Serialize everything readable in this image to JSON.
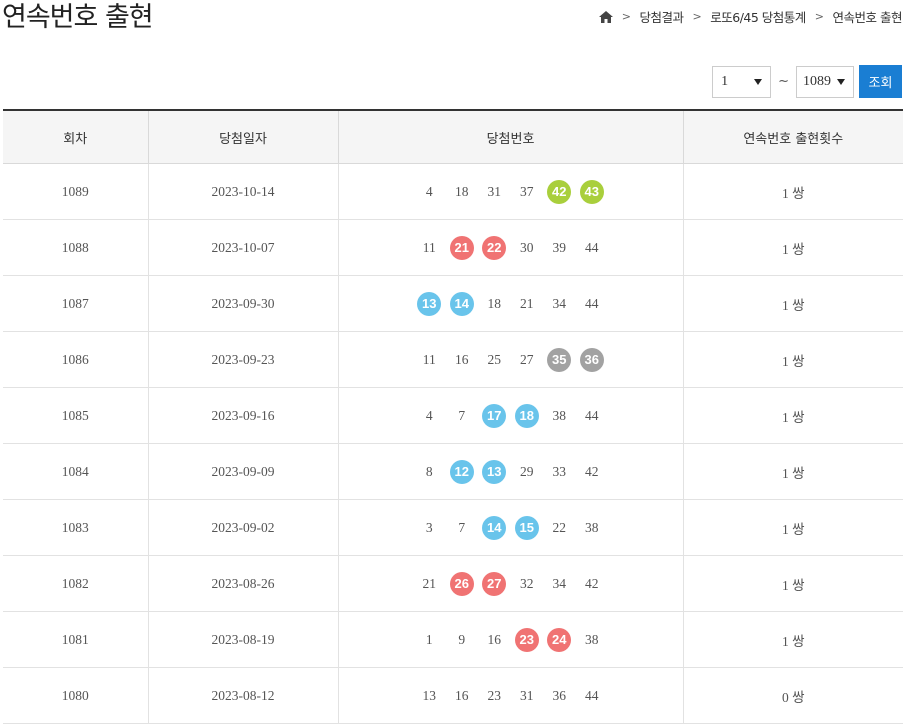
{
  "page_title": "연속번호 출현",
  "breadcrumb": {
    "home_icon": "home-icon",
    "items": [
      "당첨결과",
      "로또6/45 당첨통계",
      "연속번호 출현"
    ]
  },
  "filter": {
    "from_value": "1",
    "separator": "~",
    "to_value": "1089",
    "search_label": "조회"
  },
  "colors": {
    "yellow_green": "#a9cf3c",
    "red": "#f07373",
    "blue": "#69c4eb",
    "gray": "#a2a2a2",
    "button": "#1a7ed3"
  },
  "table": {
    "headers": [
      "회차",
      "당첨일자",
      "당첨번호",
      "연속번호 출현횟수"
    ],
    "rows": [
      {
        "round": "1089",
        "date": "2023-10-14",
        "numbers": [
          "4",
          "18",
          "31",
          "37",
          "42",
          "43"
        ],
        "highlight": [
          4,
          5
        ],
        "color": "#a9cf3c",
        "count": "1 쌍"
      },
      {
        "round": "1088",
        "date": "2023-10-07",
        "numbers": [
          "11",
          "21",
          "22",
          "30",
          "39",
          "44"
        ],
        "highlight": [
          1,
          2
        ],
        "color": "#f07373",
        "count": "1 쌍"
      },
      {
        "round": "1087",
        "date": "2023-09-30",
        "numbers": [
          "13",
          "14",
          "18",
          "21",
          "34",
          "44"
        ],
        "highlight": [
          0,
          1
        ],
        "color": "#69c4eb",
        "count": "1 쌍"
      },
      {
        "round": "1086",
        "date": "2023-09-23",
        "numbers": [
          "11",
          "16",
          "25",
          "27",
          "35",
          "36"
        ],
        "highlight": [
          4,
          5
        ],
        "color": "#a2a2a2",
        "count": "1 쌍"
      },
      {
        "round": "1085",
        "date": "2023-09-16",
        "numbers": [
          "4",
          "7",
          "17",
          "18",
          "38",
          "44"
        ],
        "highlight": [
          2,
          3
        ],
        "color": "#69c4eb",
        "count": "1 쌍"
      },
      {
        "round": "1084",
        "date": "2023-09-09",
        "numbers": [
          "8",
          "12",
          "13",
          "29",
          "33",
          "42"
        ],
        "highlight": [
          1,
          2
        ],
        "color": "#69c4eb",
        "count": "1 쌍"
      },
      {
        "round": "1083",
        "date": "2023-09-02",
        "numbers": [
          "3",
          "7",
          "14",
          "15",
          "22",
          "38"
        ],
        "highlight": [
          2,
          3
        ],
        "color": "#69c4eb",
        "count": "1 쌍"
      },
      {
        "round": "1082",
        "date": "2023-08-26",
        "numbers": [
          "21",
          "26",
          "27",
          "32",
          "34",
          "42"
        ],
        "highlight": [
          1,
          2
        ],
        "color": "#f07373",
        "count": "1 쌍"
      },
      {
        "round": "1081",
        "date": "2023-08-19",
        "numbers": [
          "1",
          "9",
          "16",
          "23",
          "24",
          "38"
        ],
        "highlight": [
          3,
          4
        ],
        "color": "#f07373",
        "count": "1 쌍"
      },
      {
        "round": "1080",
        "date": "2023-08-12",
        "numbers": [
          "13",
          "16",
          "23",
          "31",
          "36",
          "44"
        ],
        "highlight": [],
        "color": "",
        "count": "0 쌍"
      }
    ]
  }
}
